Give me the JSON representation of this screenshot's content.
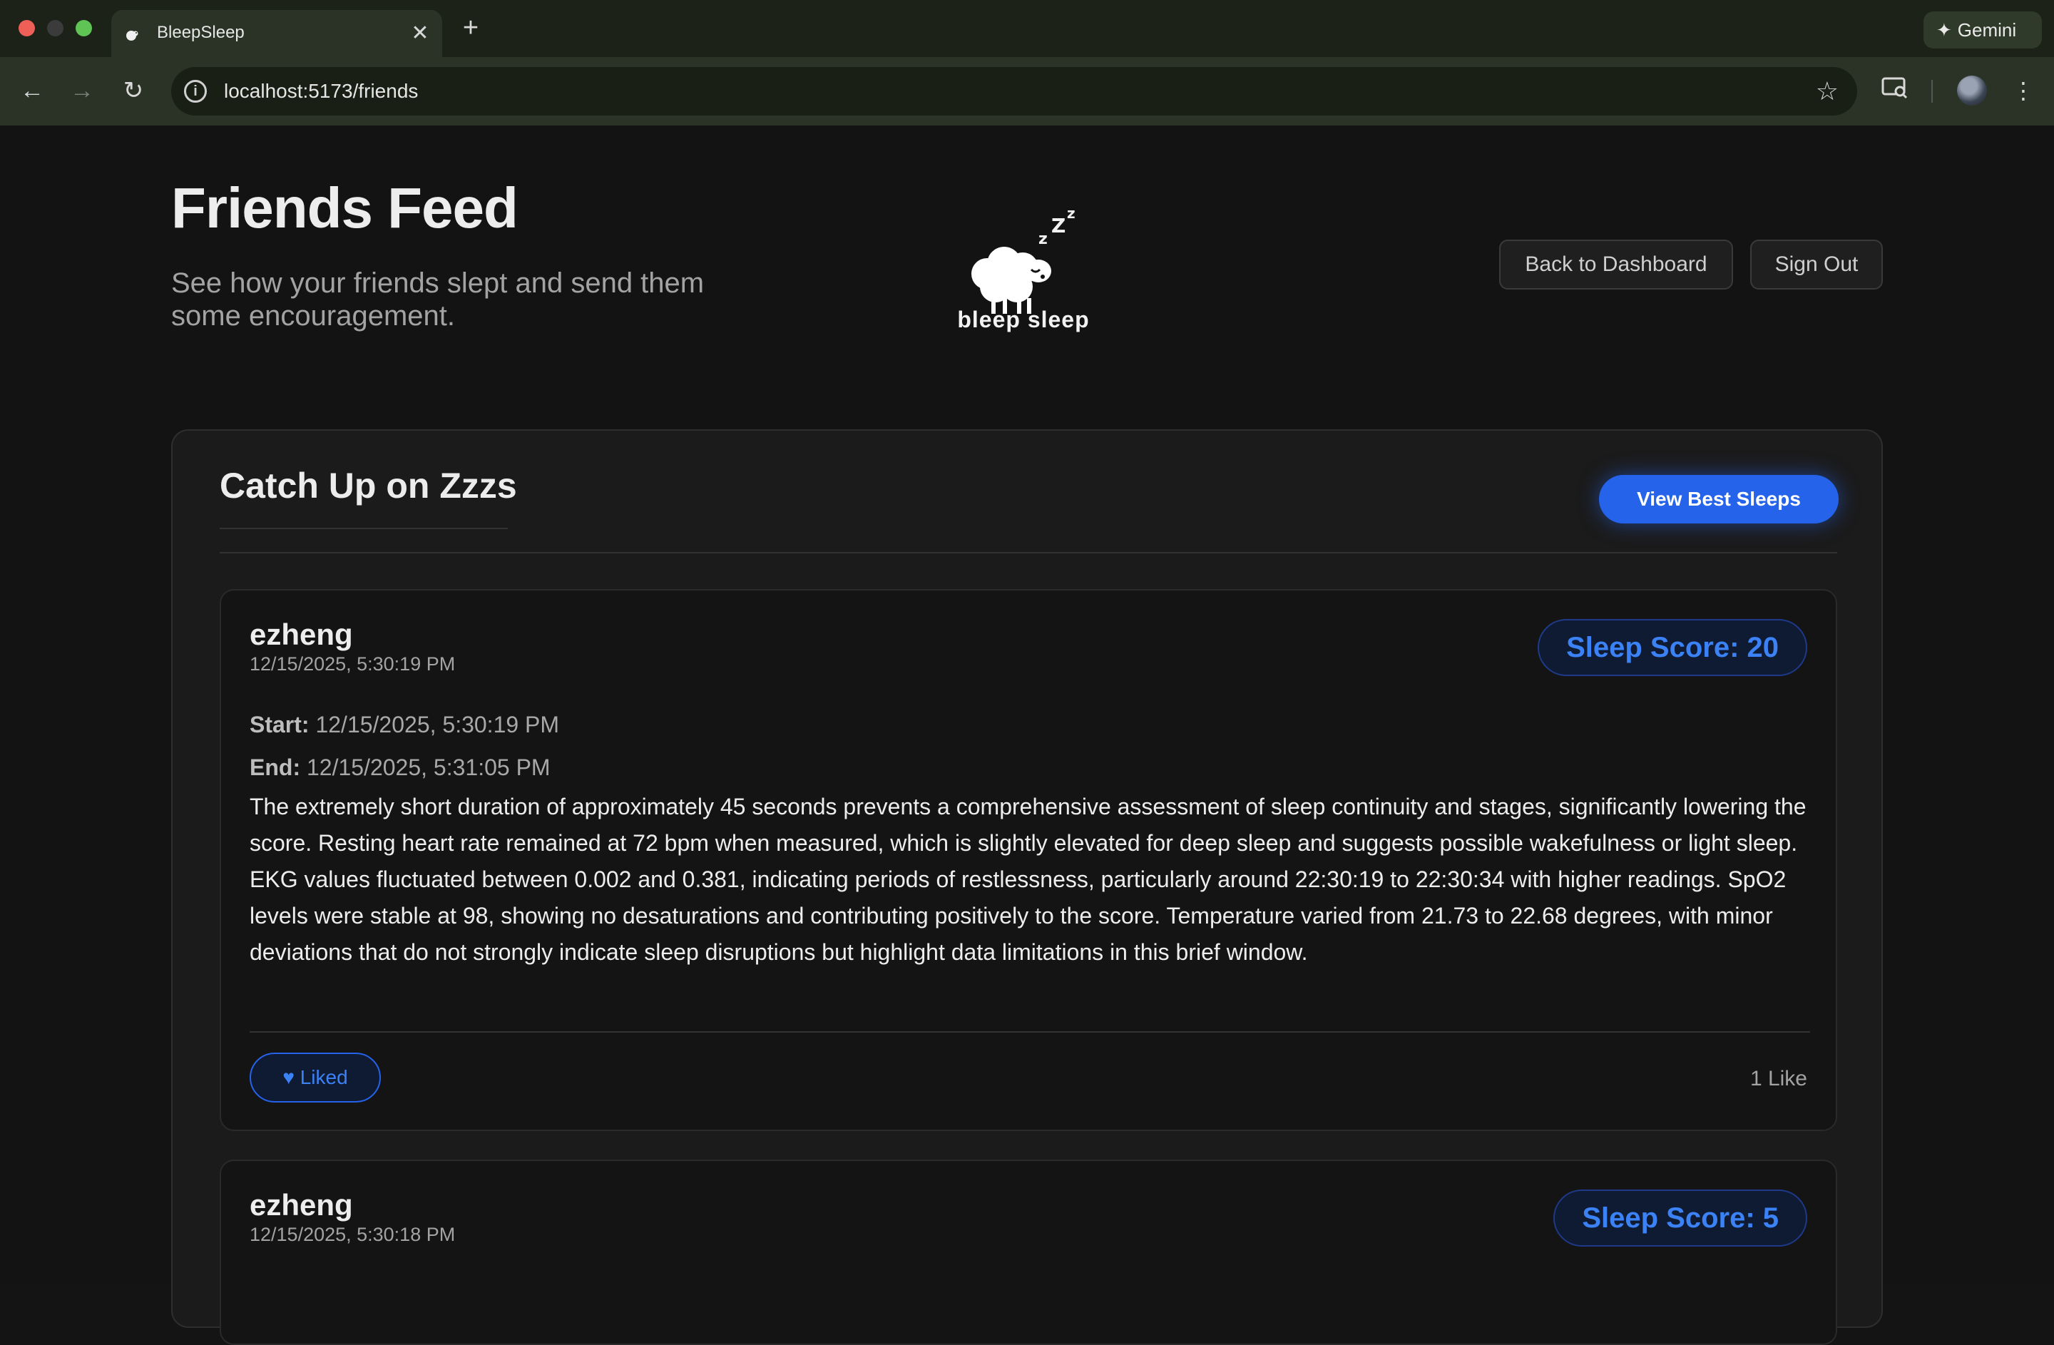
{
  "browser": {
    "tab_title": "BleepSleep",
    "tab_close": "✕",
    "new_tab": "+",
    "gemini_label": "Gemini",
    "url": "localhost:5173/friends",
    "icons": [
      "back-arrow-icon",
      "forward-arrow-icon",
      "reload-icon",
      "info-icon",
      "star-icon",
      "screen-search-icon",
      "kebab-menu-icon",
      "gemini-spark-icon"
    ]
  },
  "header": {
    "title": "Friends Feed",
    "subtitle": "See how your friends slept and send them some encouragement.",
    "logo_text": "bleep sleep",
    "back_button": "Back to Dashboard",
    "signout_button": "Sign Out"
  },
  "feed": {
    "title": "Catch Up on Zzzs",
    "best_button": "View Best Sleeps",
    "posts": [
      {
        "user": "ezheng",
        "time": "12/15/2025, 5:30:19 PM",
        "score": "Sleep Score: 20",
        "start_label": "Start:",
        "start": "12/15/2025, 5:30:19 PM",
        "end_label": "End:",
        "end": "12/15/2025, 5:31:05 PM",
        "description": "The extremely short duration of approximately 45 seconds prevents a comprehensive assessment of sleep continuity and stages, significantly lowering the score. Resting heart rate remained at 72 bpm when measured, which is slightly elevated for deep sleep and suggests possible wakefulness or light sleep. EKG values fluctuated between 0.002 and 0.381, indicating periods of restlessness, particularly around 22:30:19 to 22:30:34 with higher readings. SpO2 levels were stable at 98, showing no desaturations and contributing positively to the score. Temperature varied from 21.73 to 22.68 degrees, with minor deviations that do not strongly indicate sleep disruptions but highlight data limitations in this brief window.",
        "like_label": "Liked",
        "like_count": "1 Like"
      },
      {
        "user": "ezheng",
        "time": "12/15/2025, 5:30:18 PM",
        "score": "Sleep Score: 5"
      }
    ]
  },
  "colors": {
    "accent": "#2563eb",
    "accent_text": "#3b82f6",
    "page_bg": "#131313",
    "card_bg": "#1b1b1b",
    "browser_toolbar": "#2b3326"
  }
}
